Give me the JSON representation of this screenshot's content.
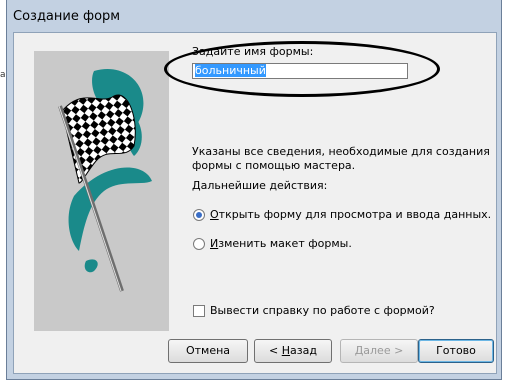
{
  "window": {
    "title": "Создание форм"
  },
  "left_strip": {
    "mark": "а"
  },
  "form_name": {
    "label": "Задайте имя формы:",
    "value": "больничный"
  },
  "info": {
    "line1": "Указаны все сведения, необходимые для создания",
    "line2": "формы с помощью мастера."
  },
  "next_actions": {
    "label": "Дальнейшие действия:",
    "options": [
      {
        "label": "Открыть форму для просмотра и ввода данных.",
        "selected": true
      },
      {
        "label": "Изменить макет формы.",
        "selected": false
      }
    ]
  },
  "help_checkbox": {
    "label": "Вывести справку по работе с формой?",
    "checked": false
  },
  "buttons": {
    "cancel": "Отмена",
    "back": "< Назад",
    "next": "Далее >",
    "finish": "Готово"
  },
  "colors": {
    "flag_accent": "#1a8a8a",
    "selection": "#3399ff",
    "annotation_ellipse": "#000000"
  },
  "icons": [
    "checkered-flag-icon"
  ]
}
